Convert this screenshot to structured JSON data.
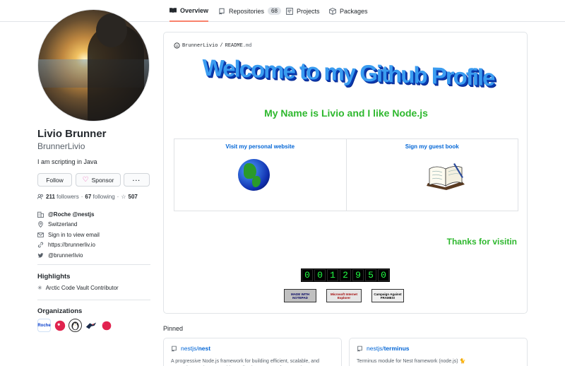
{
  "tabs": [
    {
      "label": "Overview",
      "icon": "book-icon",
      "active": true
    },
    {
      "label": "Repositories",
      "icon": "repo-icon",
      "count": "68"
    },
    {
      "label": "Projects",
      "icon": "project-icon"
    },
    {
      "label": "Packages",
      "icon": "package-icon"
    }
  ],
  "profile": {
    "fullname": "Livio Brunner",
    "username": "BrunnerLivio",
    "bio": "I am scripting in Java",
    "follow_label": "Follow",
    "sponsor_label": "Sponsor",
    "more_label": "···",
    "followers_count": "211",
    "followers_label": "followers",
    "following_count": "67",
    "following_label": "following",
    "stars_count": "507",
    "separator": "·"
  },
  "details": [
    {
      "icon": "organization-icon",
      "text": "@Roche @nestjs"
    },
    {
      "icon": "location-icon",
      "text": "Switzerland"
    },
    {
      "icon": "mail-icon",
      "text": "Sign in to view email"
    },
    {
      "icon": "link-icon",
      "text": "https://brunnerliv.io"
    },
    {
      "icon": "twitter-icon",
      "text": "@brunnerlivio"
    }
  ],
  "highlights": {
    "title": "Highlights",
    "item": "Arctic Code Vault Contributor"
  },
  "organizations": {
    "title": "Organizations",
    "items": [
      "Roche",
      "nestjs",
      "penguin",
      "bird",
      "nestjs-alt"
    ]
  },
  "readme": {
    "path_user": "BrunnerLivio",
    "path_sep": "/",
    "path_file": "README",
    "path_ext": ".md",
    "welcome": "Welcome to my Github Profile",
    "tagline": "My Name is Livio and I like Node.js",
    "website_label": "Visit my personal website",
    "guestbook_label": "Sign my guest book",
    "thanks": "Thanks for visitin",
    "counter": [
      "0",
      "0",
      "1",
      "2",
      "9",
      "5",
      "0"
    ],
    "badges": [
      "MADE WITH NOTEPAD",
      "Microsoft Internet Explorer",
      "Campaign Against FRAMES!"
    ]
  },
  "pinned": {
    "title": "Pinned",
    "cards": [
      {
        "owner": "nestjs",
        "repo": "nest",
        "desc": "A progressive Node.js framework for building efficient, scalable, and enterprise-grade server-side applications on top of TypeScript & JavaScript"
      },
      {
        "owner": "nestjs",
        "repo": "terminus",
        "desc": "Terminus module for Nest framework (node.js) 🐈"
      }
    ]
  },
  "colors": {
    "accent": "#f9826c",
    "link": "#0366d6",
    "green": "#2eb82e",
    "sponsor": "#ea4aaa"
  }
}
